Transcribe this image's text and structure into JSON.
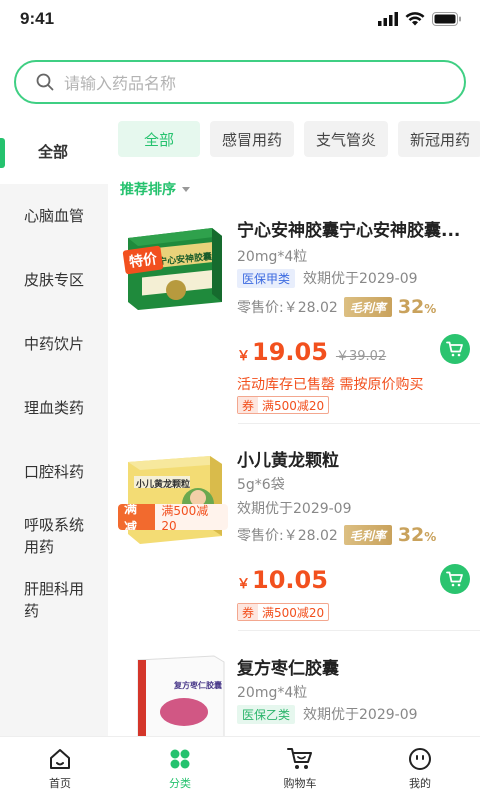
{
  "status": {
    "time": "9:41"
  },
  "search": {
    "placeholder": "请输入药品名称"
  },
  "sidebar": {
    "items": [
      {
        "label": "全部"
      },
      {
        "label": "心脑血管"
      },
      {
        "label": "皮肤专区"
      },
      {
        "label": "中药饮片"
      },
      {
        "label": "理血类药"
      },
      {
        "label": "口腔科药"
      },
      {
        "label": "呼吸系统用药"
      },
      {
        "label": "肝胆科用药"
      }
    ]
  },
  "chips": [
    {
      "label": "全部"
    },
    {
      "label": "感冒用药"
    },
    {
      "label": "支气管炎"
    },
    {
      "label": "新冠用药"
    }
  ],
  "sort": {
    "label": "推荐排序"
  },
  "products": [
    {
      "name": "宁心安神胶囊宁心安神胶囊...",
      "spec": "20mg*4粒",
      "insurance": "医保甲类",
      "expiry": "效期优于2029-09",
      "retail": "零售价:￥28.02",
      "margin_label": "毛利率",
      "margin_value": "32",
      "margin_unit": "%",
      "currency": "￥",
      "price": "19.05",
      "original_price": "￥39.02",
      "soldout": "活动库存已售罄 需按原价购买",
      "coupon_key": "券",
      "coupon_value": "满500减20",
      "image_badge": "特价",
      "box_title": "宁心安神胶囊"
    },
    {
      "name": "小儿黄龙颗粒",
      "spec": "5g*6袋",
      "expiry": "效期优于2029-09",
      "retail": "零售价:￥28.02",
      "margin_label": "毛利率",
      "margin_value": "32",
      "margin_unit": "%",
      "currency": "￥",
      "price": "10.05",
      "coupon_key": "券",
      "coupon_value": "满500减20",
      "promo_a": "满减",
      "promo_b": "满500减20",
      "box_title": "小儿黄龙颗粒"
    },
    {
      "name": "复方枣仁胶囊",
      "spec": "20mg*4粒",
      "insurance": "医保乙类",
      "expiry": "效期优于2029-09",
      "box_title": "复方枣仁胶囊"
    }
  ],
  "tabbar": [
    {
      "label": "首页"
    },
    {
      "label": "分类"
    },
    {
      "label": "购物车"
    },
    {
      "label": "我的"
    }
  ],
  "colors": {
    "accent": "#25c26e",
    "price": "#f2501e",
    "gold": "#c9a25c"
  }
}
